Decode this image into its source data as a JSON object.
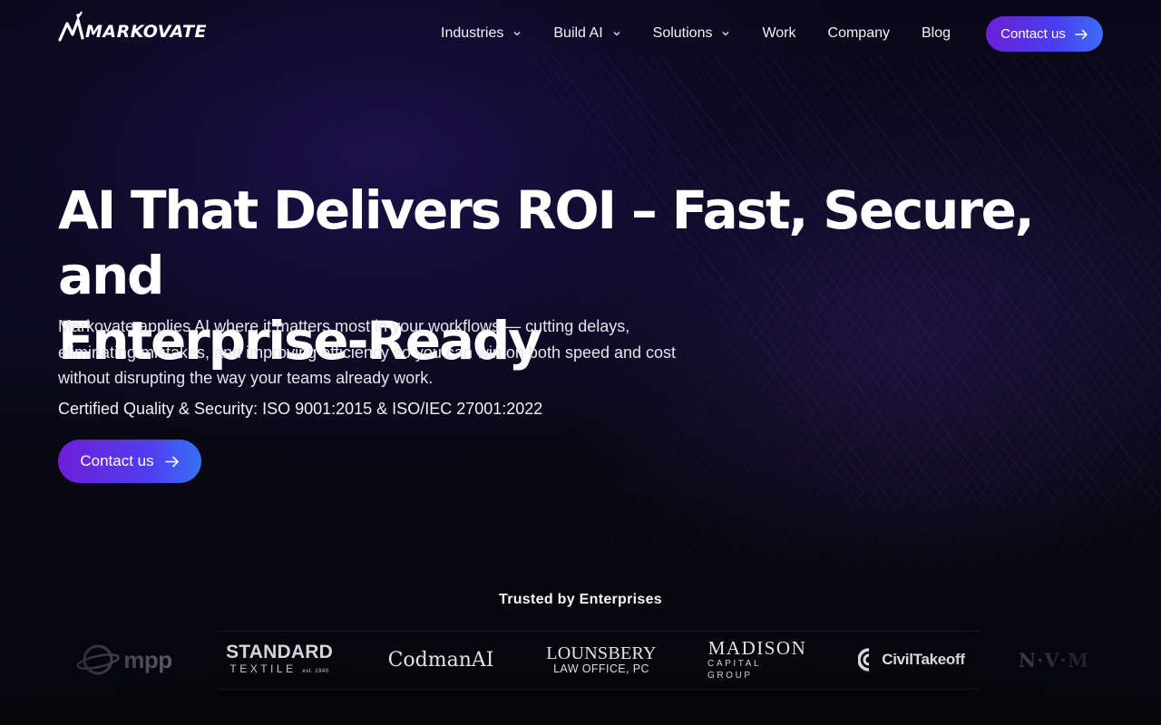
{
  "header": {
    "logo_text": "MARKOVATE",
    "nav": [
      {
        "label": "Industries",
        "has_dropdown": true
      },
      {
        "label": "Build AI",
        "has_dropdown": true
      },
      {
        "label": "Solutions",
        "has_dropdown": true
      },
      {
        "label": "Work",
        "has_dropdown": false
      },
      {
        "label": "Company",
        "has_dropdown": false
      },
      {
        "label": "Blog",
        "has_dropdown": false
      }
    ],
    "cta_label": "Contact us"
  },
  "hero": {
    "title_line1": "AI That Delivers ROI – Fast, Secure, and",
    "title_line2": "Enterprise-Ready",
    "description": "Markovate applies AI where it matters most in your workflows — cutting delays, eliminating mistakes, and improving efficiency so you can win on both speed and cost without disrupting the way your teams already work.",
    "certification": "Certified Quality & Security: ISO 9001:2015 & ISO/IEC 27001:2022",
    "cta_label": "Contact us"
  },
  "trusted": {
    "title": "Trusted by Enterprises",
    "logos": {
      "mpp": "mpp",
      "standard_line1": "STANDARD",
      "standard_line2": "TEXTILE",
      "standard_est": "est. 1940",
      "codman": "CodmanAI",
      "lounsbery_line1": "LOUNSBERY",
      "lounsbery_line2": "LAW OFFICE, PC",
      "madison_line1": "MADISON",
      "madison_line2": "CAPITAL GROUP",
      "civil": "CivilTakeoff",
      "nvm": "N·V·M"
    }
  },
  "colors": {
    "background": "#07060d",
    "accent_gradient_start": "#6b21d8",
    "accent_gradient_end": "#3b6ef5",
    "text": "#ffffff"
  },
  "icons": {
    "dropdown": "chevron-down-icon",
    "cta_arrow": "arrow-right-icon",
    "logo_mark": "upward-arrow-icon"
  }
}
